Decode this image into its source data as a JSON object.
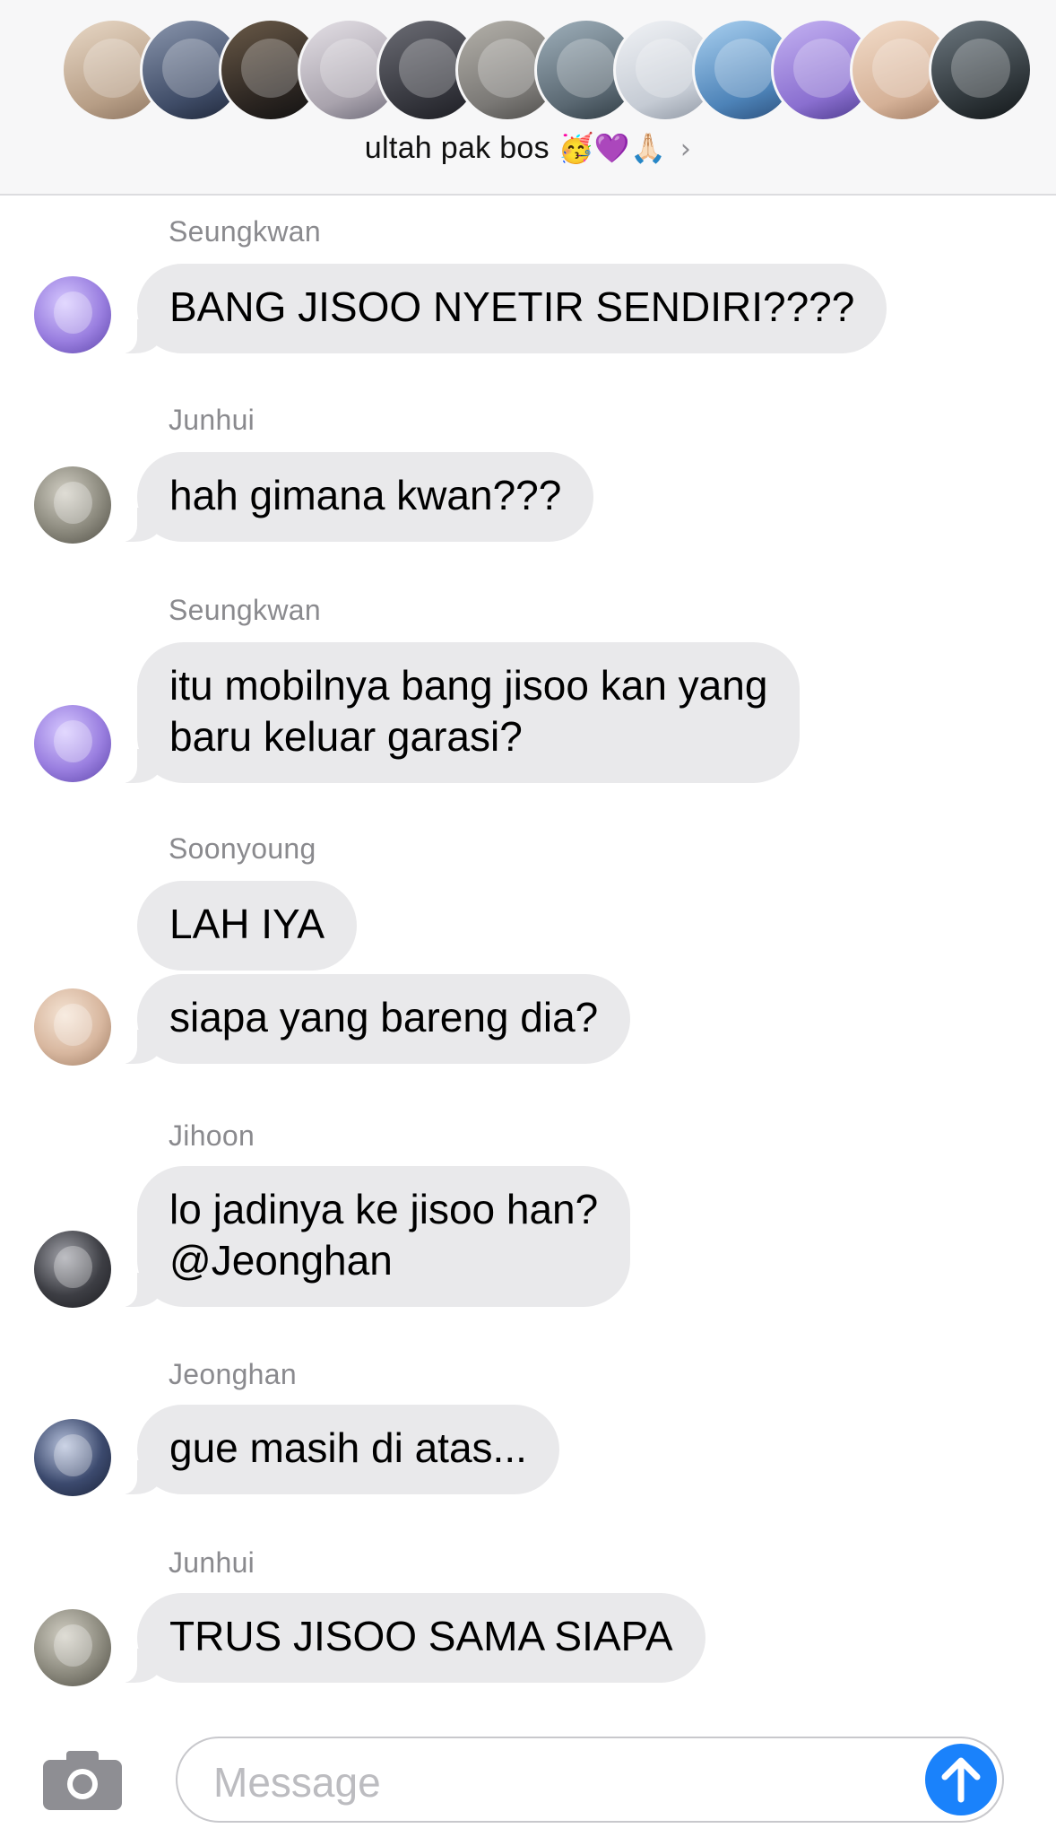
{
  "header": {
    "group_name": "ultah pak bos",
    "emoji": "🥳💜🙏🏻",
    "chevron": "›",
    "avatars": [
      {
        "name": "member-1",
        "color": "#c9b3a0"
      },
      {
        "name": "member-2",
        "color": "#4b5a78"
      },
      {
        "name": "member-3",
        "color": "#2a2622"
      },
      {
        "name": "member-4",
        "color": "#b7b2b8"
      },
      {
        "name": "member-5",
        "color": "#3a3b43"
      },
      {
        "name": "member-6",
        "color": "#7b7a78"
      },
      {
        "name": "member-7",
        "color": "#5c6a74"
      },
      {
        "name": "member-8",
        "color": "#c8ced6"
      },
      {
        "name": "member-9",
        "color": "#4d7fb4"
      },
      {
        "name": "member-10",
        "color": "#8a6fd0"
      },
      {
        "name": "member-11",
        "color": "#d9b69d"
      },
      {
        "name": "member-12",
        "color": "#2d3438"
      }
    ]
  },
  "messages": [
    {
      "sender": "Seungkwan",
      "text": "BANG JISOO NYETIR SENDIRI????"
    },
    {
      "sender": "Junhui",
      "text": "hah gimana kwan???"
    },
    {
      "sender": "Seungkwan",
      "text": "itu mobilnya bang jisoo kan yang\nbaru keluar garasi?"
    },
    {
      "sender": "Soonyoung",
      "text": "LAH IYA"
    },
    {
      "sender": "",
      "text": "siapa yang bareng dia?"
    },
    {
      "sender": "Jihoon",
      "text": "lo jadinya ke jisoo han?\n@Jeonghan"
    },
    {
      "sender": "Jeonghan",
      "text": "gue masih di atas..."
    },
    {
      "sender": "Junhui",
      "text": "TRUS JISOO SAMA SIAPA"
    }
  ],
  "composer": {
    "placeholder": "Message"
  },
  "colors": {
    "bubble": "#e9e9eb",
    "send": "#1a82fb",
    "seungkwan_avatar": "#9a7fe0",
    "junhui_avatar": "#8c8a7e",
    "soonyoung_avatar": "#d8b79f",
    "jihoon_avatar": "#3d3e44",
    "jeonghan_avatar": "#3c4a6e"
  }
}
